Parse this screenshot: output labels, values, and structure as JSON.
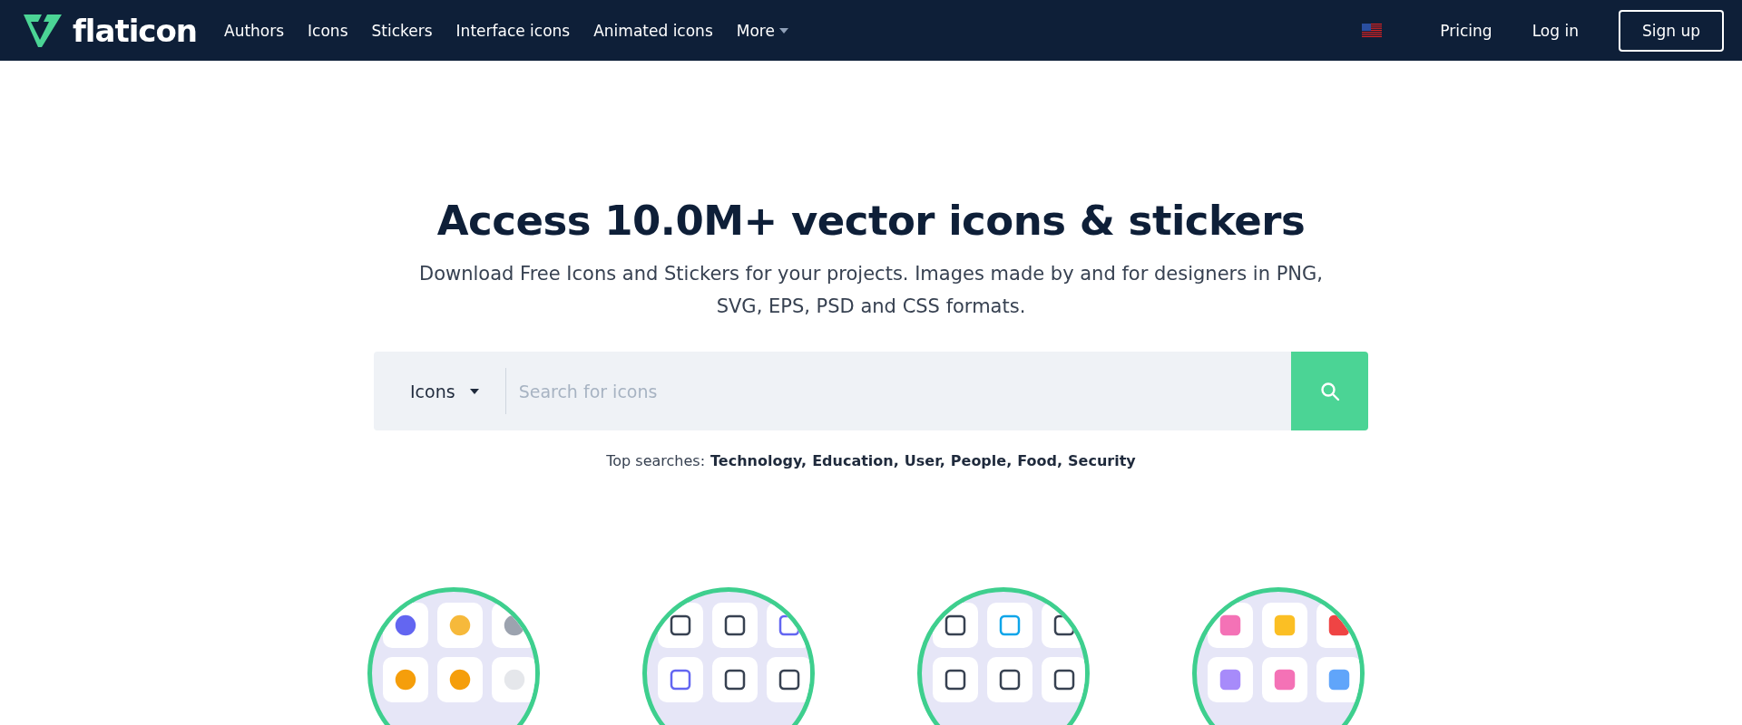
{
  "header": {
    "logo": "flaticon",
    "nav": [
      {
        "label": "Authors",
        "kind": "link"
      },
      {
        "label": "Icons",
        "kind": "link"
      },
      {
        "label": "Stickers",
        "kind": "link"
      },
      {
        "label": "Interface icons",
        "kind": "link"
      },
      {
        "label": "Animated icons",
        "kind": "link"
      },
      {
        "label": "More",
        "kind": "dropdown"
      }
    ],
    "pricing": "Pricing",
    "login": "Log in",
    "signup": "Sign up"
  },
  "hero": {
    "title": "Access 10.0M+ vector icons & stickers",
    "subtitle": "Download Free Icons and Stickers for your projects. Images made by and for designers in PNG, SVG, EPS, PSD and CSS formats."
  },
  "search": {
    "type": "Icons",
    "placeholder": "Search for icons"
  },
  "top_searches": {
    "label": "Top searches:",
    "items": [
      "Technology,",
      "Education,",
      "User,",
      "People,",
      "Food,",
      "Security"
    ]
  }
}
